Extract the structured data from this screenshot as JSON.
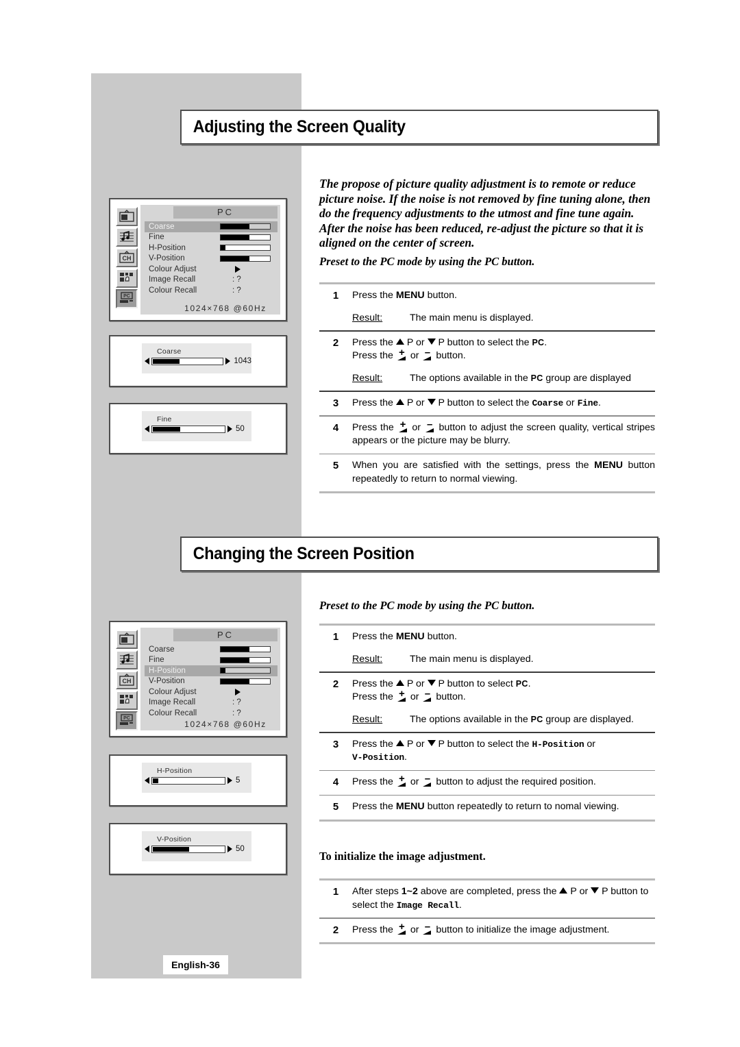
{
  "page": {
    "footer_label": "English-36",
    "background": "#ffffff",
    "sidebar_color": "#c9c9c9"
  },
  "sections": [
    {
      "title": "Adjusting the Screen Quality",
      "intro": "The propose of picture quality adjustment is to remote or reduce picture noise. If the noise is not removed by fine tuning alone, then do the frequency adjustments to the utmost and fine tune again. After the noise has been reduced, re-adjust the picture so that it is aligned on the center of screen.",
      "lead": "Preset to the PC mode by using the PC button.",
      "steps": [
        {
          "num": "1",
          "text_html": "Press the <b class=\"k\">MENU</b> button.",
          "result_label": "Result:",
          "result_text": "The main menu is displayed."
        },
        {
          "num": "2",
          "text_html": "Press the TRIUP P or TRIDN P button to select the <span class=\"sc\">PC</span>.<br>Press the PLUSBTN or MINUSBTN button.",
          "result_label": "Result:",
          "result_text": "The options available in the PC group are displayed"
        },
        {
          "num": "3",
          "text_html": "Press the TRIUP P or TRIDN P button to select the <span class=\"mono\">Coarse</span> or <span class=\"mono\">Fine</span>."
        },
        {
          "num": "4",
          "text_html": "Press the PLUSBTN or MINUSBTN button to adjust the screen quality, vertical stripes appears or the picture may be blurry."
        },
        {
          "num": "5",
          "text_html": "When you are satisfied with the settings, press the <b class=\"k\">MENU</b> button repeatedly to return to normal viewing."
        }
      ]
    },
    {
      "title": "Changing the Screen Position",
      "lead": "Preset to the PC mode by using the PC button.",
      "steps": [
        {
          "num": "1",
          "text_html": "Press the <b class=\"k\">MENU</b> button.",
          "result_label": "Result:",
          "result_text": "The main menu is displayed."
        },
        {
          "num": "2",
          "text_html": "Press the TRIUP P or TRIDN P button to select <span class=\"sc\">PC</span>.<br>Press the PLUSBTN or MINUSBTN button.",
          "result_label": "Result:",
          "result_text": "The options available in the PC group are displayed."
        },
        {
          "num": "3",
          "text_html": "Press the TRIUP P or TRIDN P button to select the <span class=\"mono\">H-Position</span> or<br><span class=\"mono\">V-Position</span>."
        },
        {
          "num": "4",
          "text_html": "Press the PLUSBTN or MINUSBTN button to adjust the required position."
        },
        {
          "num": "5",
          "text_html": "Press the <b class=\"k\">MENU</b> button repeatedly to return to nomal viewing."
        }
      ],
      "subhead": "To initialize the image adjustment.",
      "sub_steps": [
        {
          "num": "1",
          "text_html": "After steps <b class=\"k\">1~2</b> above are completed, press the TRIUP P or TRIDN P button to select the <span class=\"mono\">Image Recall</span>."
        },
        {
          "num": "2",
          "text_html": "Press the PLUSBTN or MINUSBTN button to initialize the image adjustment."
        }
      ]
    }
  ],
  "osd_menus": [
    {
      "name": "screen-quality-menu",
      "header": "PC",
      "resolution": "1024×768  @60Hz",
      "selected": "Coarse",
      "rows": [
        {
          "label": "Coarse",
          "kind": "bar",
          "fill_pct": 58,
          "value": null
        },
        {
          "label": "Fine",
          "kind": "bar",
          "fill_pct": 58,
          "value": null
        },
        {
          "label": "H-Position",
          "kind": "bar",
          "fill_pct": 10,
          "value": null
        },
        {
          "label": "V-Position",
          "kind": "bar",
          "fill_pct": 58,
          "value": null
        },
        {
          "label": "Colour Adjust",
          "kind": "arrow",
          "fill_pct": 0,
          "value": null
        },
        {
          "label": "Image Recall",
          "kind": "value",
          "fill_pct": 0,
          "value": ": ?"
        },
        {
          "label": "Colour Recall",
          "kind": "value",
          "fill_pct": 0,
          "value": ": ?"
        }
      ],
      "rail_icons": [
        "picture-icon",
        "sound-icon",
        "channel-icon",
        "feature-icon",
        "pc-icon"
      ],
      "rail_selected_index": 4
    },
    {
      "name": "screen-position-menu",
      "header": "PC",
      "resolution": "1024×768  @60Hz",
      "selected": "H-Position",
      "rows": [
        {
          "label": "Coarse",
          "kind": "bar",
          "fill_pct": 58,
          "value": null
        },
        {
          "label": "Fine",
          "kind": "bar",
          "fill_pct": 58,
          "value": null
        },
        {
          "label": "H-Position",
          "kind": "bar",
          "fill_pct": 10,
          "value": null
        },
        {
          "label": "V-Position",
          "kind": "bar",
          "fill_pct": 58,
          "value": null
        },
        {
          "label": "Colour Adjust",
          "kind": "arrow",
          "fill_pct": 0,
          "value": null
        },
        {
          "label": "Image Recall",
          "kind": "value",
          "fill_pct": 0,
          "value": ": ?"
        },
        {
          "label": "Colour Recall",
          "kind": "value",
          "fill_pct": 0,
          "value": ": ?"
        }
      ],
      "rail_icons": [
        "picture-icon",
        "sound-icon",
        "channel-icon",
        "feature-icon",
        "pc-icon"
      ],
      "rail_selected_index": 4
    }
  ],
  "osd_sliders": [
    {
      "name": "coarse-slider",
      "label": "Coarse",
      "value": "1043",
      "fill_pct": 38
    },
    {
      "name": "fine-slider",
      "label": "Fine",
      "value": "50",
      "fill_pct": 38
    },
    {
      "name": "h-position-slider",
      "label": "H-Position",
      "value": "5",
      "fill_pct": 8
    },
    {
      "name": "v-position-slider",
      "label": "V-Position",
      "value": "50",
      "fill_pct": 50
    }
  ]
}
